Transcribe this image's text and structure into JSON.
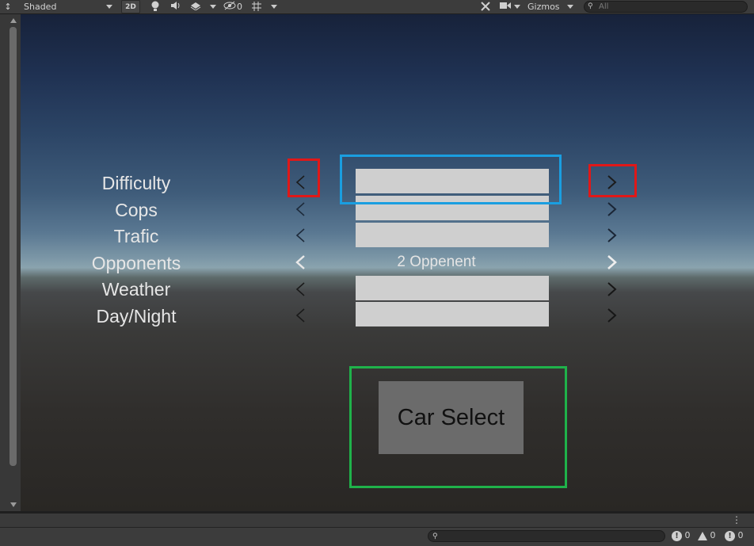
{
  "toolbar": {
    "shading_mode": "Shaded",
    "mode_2d": "2D",
    "gizmo_hidden_count": "0",
    "gizmos_label": "Gizmos",
    "search_placeholder": "All"
  },
  "menu": {
    "rows": [
      {
        "label": "Difficulty",
        "value": ""
      },
      {
        "label": "Cops",
        "value": ""
      },
      {
        "label": "Trafic",
        "value": ""
      },
      {
        "label": "Opponents",
        "value": "2 Oppenent"
      },
      {
        "label": "Weather",
        "value": ""
      },
      {
        "label": "Day/Night",
        "value": ""
      }
    ],
    "car_select_label": "Car Select"
  },
  "highlight_colors": {
    "red": "#e01818",
    "blue": "#1a9ee0",
    "green": "#1fb24a"
  },
  "status": {
    "error_count": "0",
    "warning_count": "0",
    "info_count": "0"
  }
}
